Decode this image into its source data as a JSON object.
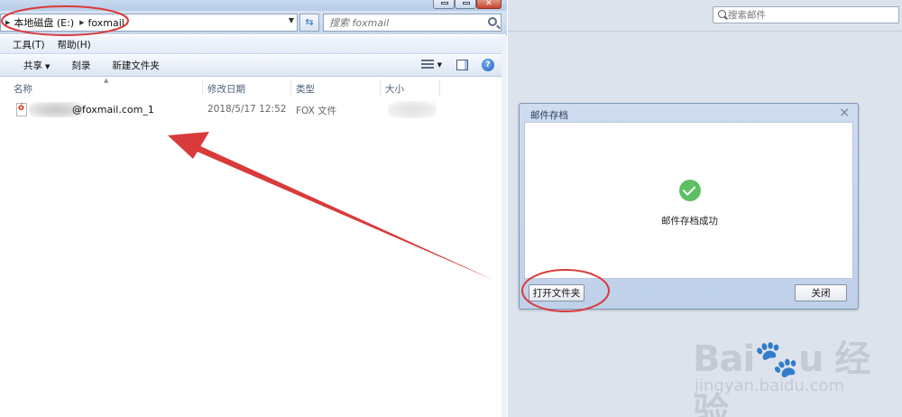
{
  "explorer": {
    "address": {
      "drive": "本地磁盘 (E:)",
      "folder": "foxmail"
    },
    "search_placeholder": "搜索 foxmail",
    "menu": [
      "工具(T)",
      "帮助(H)"
    ],
    "toolbar": {
      "share": "共享",
      "burn": "刻录",
      "new_folder": "新建文件夹"
    },
    "columns": {
      "name": "名称",
      "modified": "修改日期",
      "type": "类型",
      "size": "大小"
    },
    "file": {
      "name_visible": "@foxmail.com_1",
      "modified": "2018/5/17 12:52",
      "type": "FOX 文件"
    }
  },
  "foxmail": {
    "search_placeholder": "搜索邮件",
    "dialog": {
      "title": "邮件存档",
      "message": "邮件存档成功",
      "open_folder": "打开文件夹",
      "close": "关闭"
    }
  },
  "watermark": {
    "url": "jingyan.baidu.com"
  },
  "colors": {
    "annotation_red": "#d93a3a",
    "success_green": "#5dc064"
  }
}
